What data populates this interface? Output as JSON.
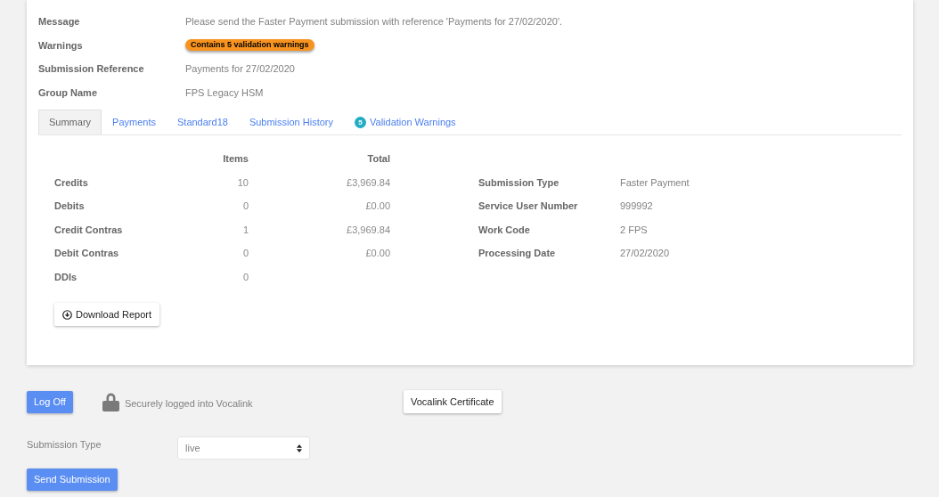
{
  "details": [
    {
      "kind": "text",
      "label": "Message",
      "value": "Please send the Faster Payment submission with reference 'Payments for 27/02/2020'."
    },
    {
      "kind": "badge",
      "label": "Warnings",
      "value": "Contains 5 validation warnings"
    },
    {
      "kind": "text",
      "label": "Submission Reference",
      "value": "Payments for 27/02/2020"
    },
    {
      "kind": "text",
      "label": "Group Name",
      "value": "FPS Legacy HSM"
    }
  ],
  "tabs": [
    {
      "label": "Summary",
      "selected": true
    },
    {
      "label": "Payments",
      "selected": false
    },
    {
      "label": "Standard18",
      "selected": false
    },
    {
      "label": "Submission History",
      "selected": false
    },
    {
      "label": "Validation Warnings",
      "count": "5",
      "selected": false
    }
  ],
  "summary": {
    "columns": [
      "Items",
      "Total"
    ],
    "rows": [
      {
        "label": "Credits",
        "items": "10",
        "total": "£3,969.84"
      },
      {
        "label": "Debits",
        "items": "0",
        "total": "£0.00"
      },
      {
        "label": "Credit Contras",
        "items": "1",
        "total": "£3,969.84"
      },
      {
        "label": "Debit Contras",
        "items": "0",
        "total": "£0.00"
      },
      {
        "label": "DDIs",
        "items": "0"
      }
    ],
    "download_button": "Download Report"
  },
  "info": [
    {
      "label": "Submission Type",
      "value": "Faster Payment"
    },
    {
      "label": "Service User Number",
      "value": "999992"
    },
    {
      "label": "Work Code",
      "value": "2 FPS"
    },
    {
      "label": "Processing Date",
      "value": "27/02/2020"
    }
  ],
  "footer": {
    "log_off_button": "Log Off",
    "login_status": "Securely logged into Vocalink",
    "certificate_button": "Vocalink Certificate",
    "submission_type": {
      "label": "Submission Type",
      "value": "live"
    },
    "send_button": "Send Submission"
  }
}
